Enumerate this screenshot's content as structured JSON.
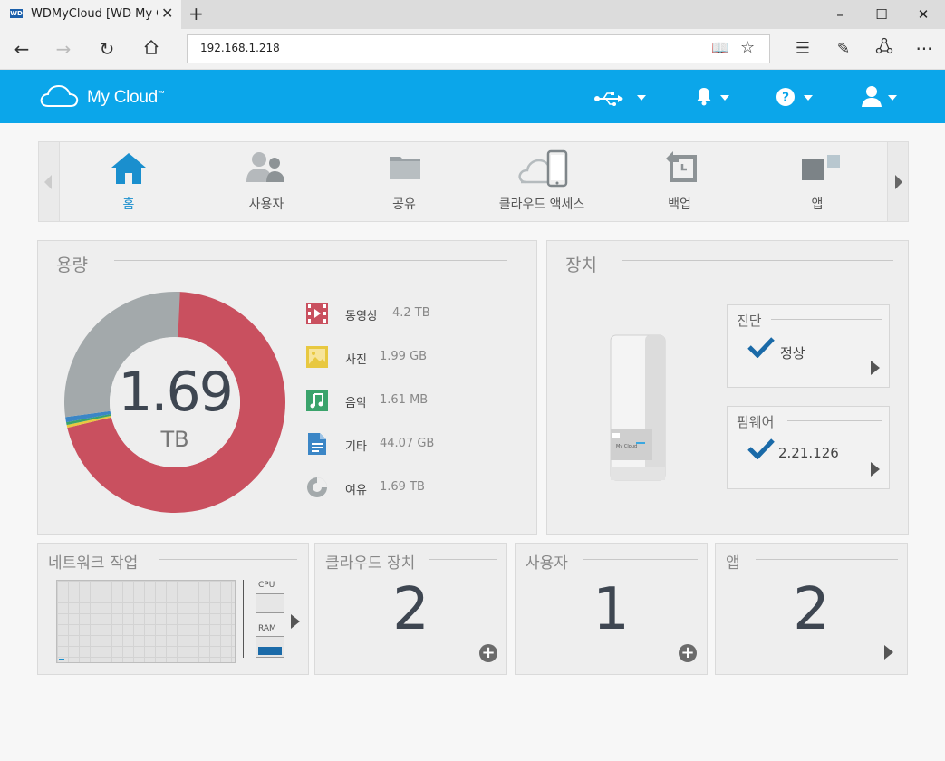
{
  "browser": {
    "tab_title": "WDMyCloud [WD My C",
    "tab_favicon": "WD",
    "url": "192.168.1.218",
    "window_buttons": [
      "minimize",
      "maximize",
      "close"
    ]
  },
  "header": {
    "logo_text": "My Cloud",
    "logo_tm": "™",
    "icons": [
      "usb-icon",
      "bell-icon",
      "help-icon",
      "user-icon"
    ]
  },
  "nav": {
    "items": [
      {
        "label": "홈",
        "icon": "home-icon",
        "active": true
      },
      {
        "label": "사용자",
        "icon": "users-icon",
        "active": false
      },
      {
        "label": "공유",
        "icon": "folder-icon",
        "active": false
      },
      {
        "label": "클라우드 액세스",
        "icon": "cloud-phone-icon",
        "active": false
      },
      {
        "label": "백업",
        "icon": "backup-icon",
        "active": false
      },
      {
        "label": "앱",
        "icon": "apps-icon",
        "active": false
      }
    ]
  },
  "capacity": {
    "title": "용량",
    "total_value": "1.69",
    "total_unit": "TB",
    "legend": [
      {
        "name": "동영상",
        "value": "4.2 TB",
        "icon": "video-icon",
        "color": "#c9505f"
      },
      {
        "name": "사진",
        "value": "1.99 GB",
        "icon": "photo-icon",
        "color": "#e8c840"
      },
      {
        "name": "음악",
        "value": "1.61 MB",
        "icon": "music-icon",
        "color": "#3aa36b"
      },
      {
        "name": "기타",
        "value": "44.07 GB",
        "icon": "document-icon",
        "color": "#3b86c6"
      },
      {
        "name": "여유",
        "value": "1.69 TB",
        "icon": "free-space-icon",
        "color": "#a3a9ab"
      }
    ],
    "chart_fractions": {
      "video": 0.713,
      "photo": 0.0005,
      "music": 0.0001,
      "other": 0.0075,
      "free": 0.279
    }
  },
  "device": {
    "title": "장치",
    "diagnostics": {
      "title": "진단",
      "status": "정상"
    },
    "firmware": {
      "title": "펌웨어",
      "version": "2.21.126"
    },
    "device_label": "My Cloud"
  },
  "network": {
    "title": "네트워크 작업",
    "cpu_label": "CPU",
    "ram_label": "RAM",
    "ram_level": 0.5
  },
  "stats": {
    "cloud_devices": {
      "title": "클라우드 장치",
      "value": "2"
    },
    "users": {
      "title": "사용자",
      "value": "1"
    },
    "apps": {
      "title": "앱",
      "value": "2"
    }
  },
  "colors": {
    "header_blue": "#0ba6ea",
    "active_nav": "#1a8fce",
    "check_blue": "#1a6aa8",
    "donut_red": "#c9505f",
    "donut_grey": "#a3a9ab"
  }
}
